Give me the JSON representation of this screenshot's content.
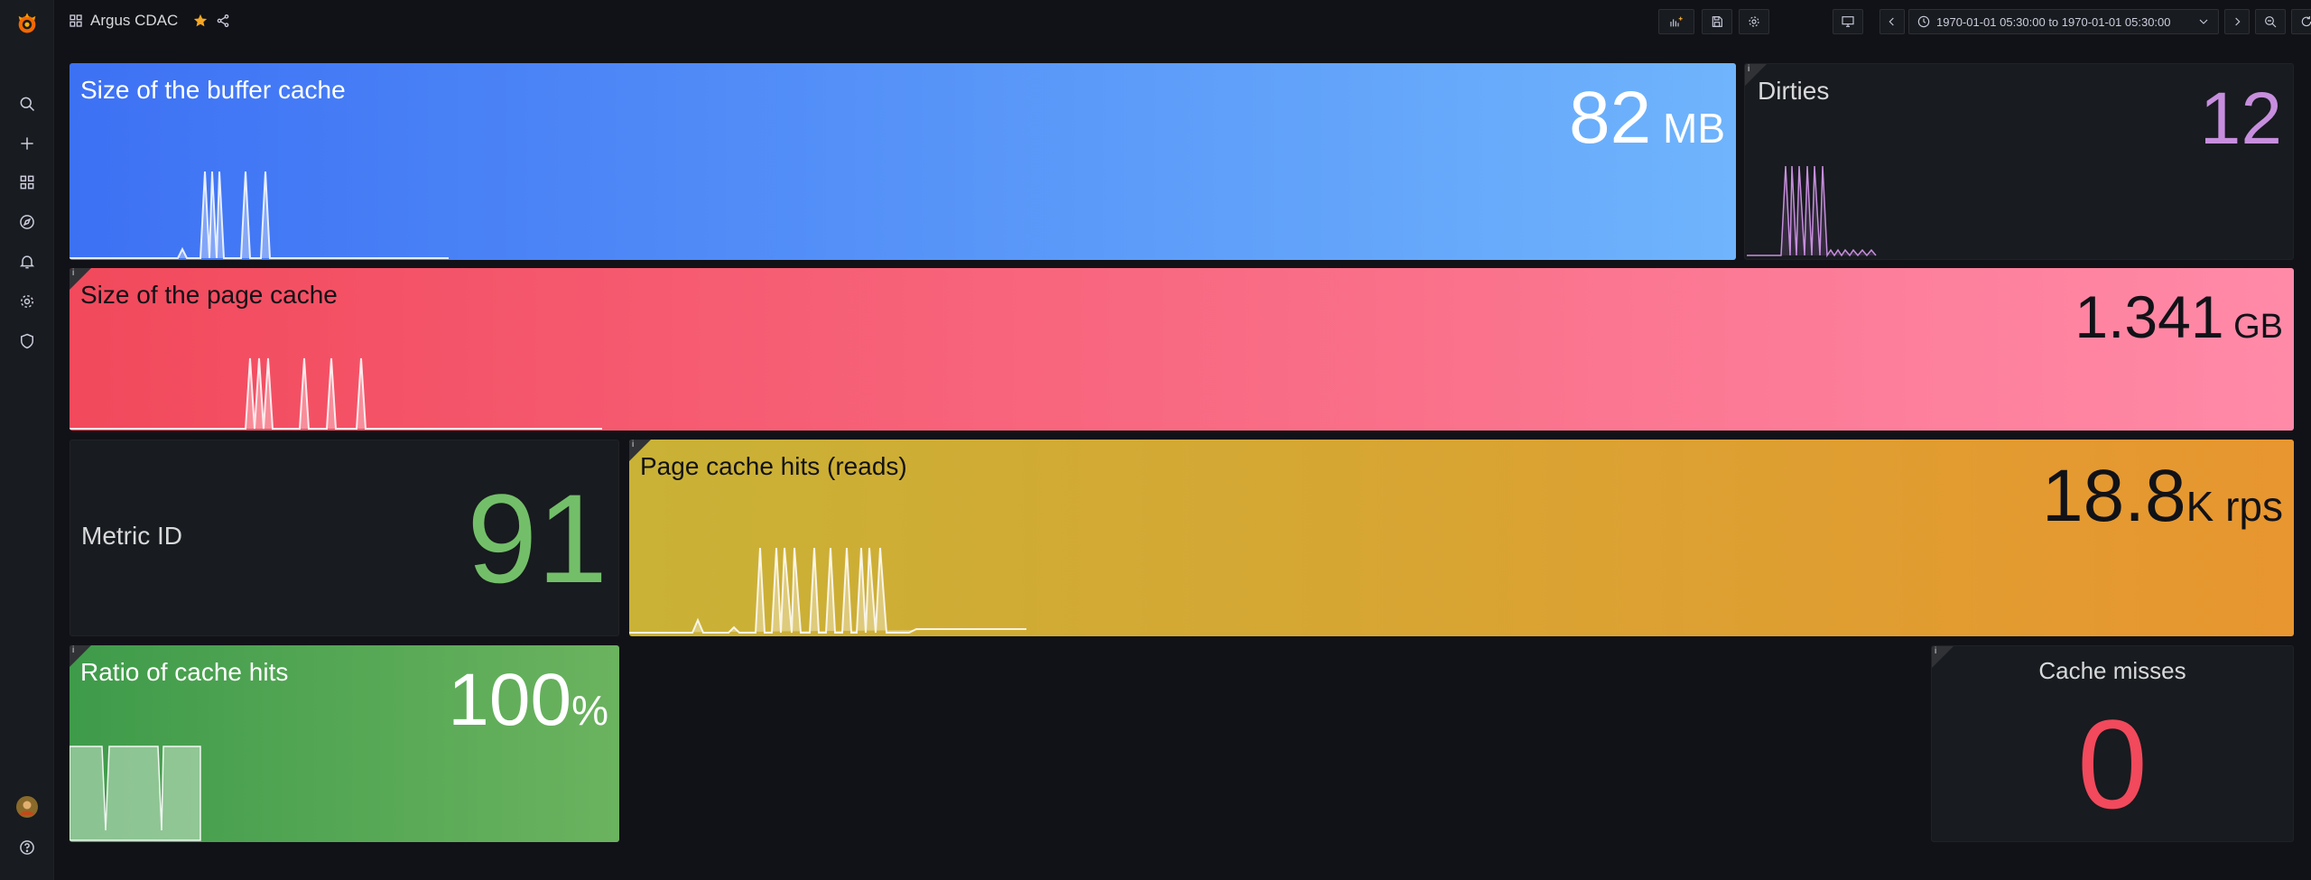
{
  "header": {
    "dashboard_title": "Argus CDAC",
    "time_range": "1970-01-01 05:30:00 to 1970-01-01 05:30:00"
  },
  "panels": {
    "buffer_cache": {
      "title": "Size of the buffer cache",
      "value": "82",
      "unit": " MB"
    },
    "dirties": {
      "title": "Dirties",
      "value": "12"
    },
    "page_cache": {
      "title": "Size of the page cache",
      "value": "1.341",
      "unit": " GB"
    },
    "metric_id": {
      "title": "Metric ID",
      "value": "91"
    },
    "page_cache_hits": {
      "title": "Page cache hits (reads)",
      "value": "18.8",
      "unit": "K rps"
    },
    "ratio_cache_hits": {
      "title": "Ratio of cache hits",
      "value": "100",
      "unit": "%"
    },
    "cache_misses": {
      "title": "Cache misses",
      "value": "0"
    }
  },
  "info_marker": "i",
  "colors": {
    "blue_start": "#3d71f4",
    "blue_end": "#6fb4fc",
    "red_start": "#f2495c",
    "red_end": "#ff8aa8",
    "orange_start": "#c9b236",
    "orange_end": "#e8962f",
    "green_start": "#3e9b4a",
    "green_end": "#6bb35f",
    "purple": "#c78ede",
    "lightgreen": "#73bf69",
    "misses_red": "#f2495c",
    "dark_panel": "#181b1f"
  }
}
